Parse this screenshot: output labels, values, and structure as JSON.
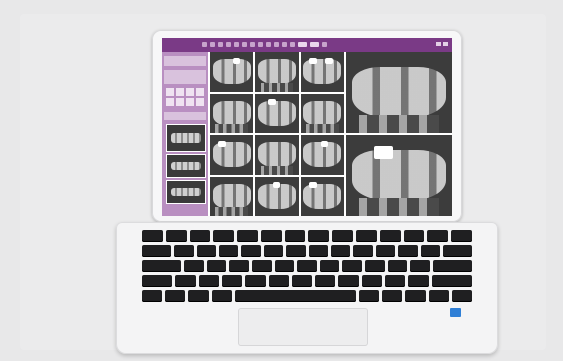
{
  "app": {
    "title": "",
    "accent_color": "#7a3a86",
    "sidebar_color": "#b98fc1"
  },
  "toolbar": {
    "icons": [
      "tool-icon",
      "tool-icon",
      "tool-icon",
      "tool-icon",
      "tool-icon",
      "tool-icon",
      "tool-icon",
      "tool-icon",
      "tool-icon",
      "tool-icon",
      "tool-icon",
      "tool-icon",
      "tool-icon",
      "tool-icon",
      "tool-icon"
    ]
  },
  "images": {
    "small_grid_count": 12,
    "large_grid_count": 2
  },
  "device": {
    "sticker_color": "#2f7fd6"
  }
}
